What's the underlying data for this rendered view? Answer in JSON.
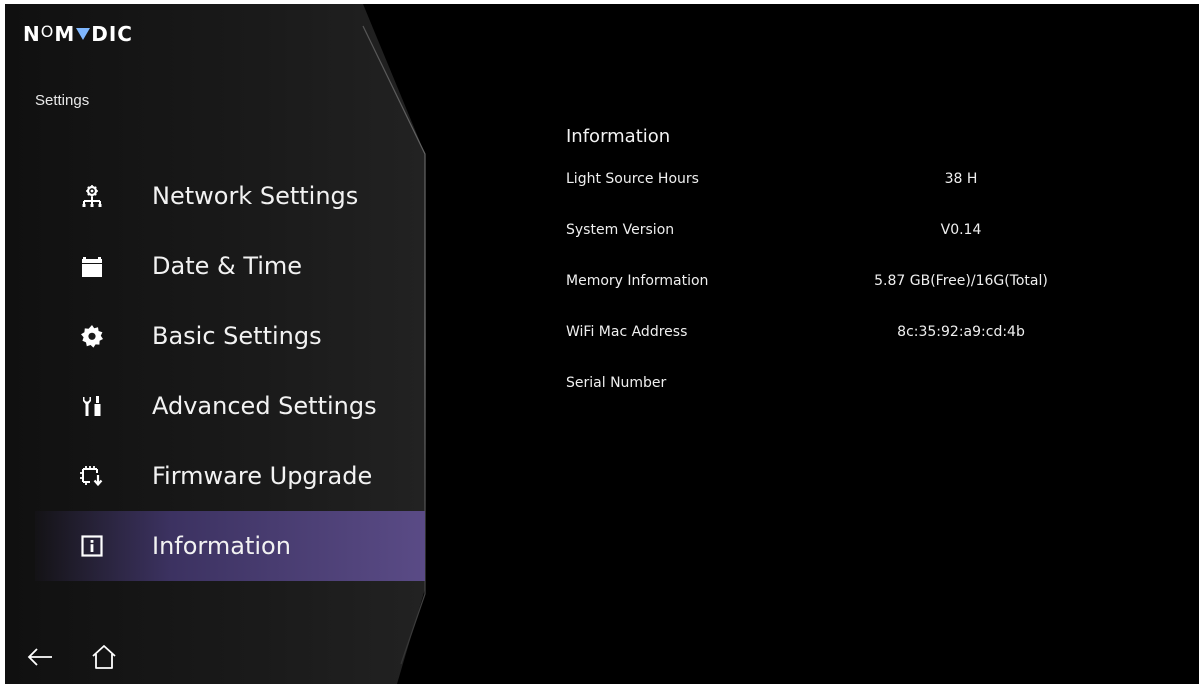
{
  "brand": {
    "logo_n": "N",
    "logo_o": "O",
    "logo_m": "M",
    "logo_rest": "DIC",
    "accent_color": "#7fb7ff"
  },
  "sidebar": {
    "title": "Settings",
    "items": [
      {
        "label": "Network Settings",
        "icon": "network-icon"
      },
      {
        "label": "Date & Time",
        "icon": "calendar-icon"
      },
      {
        "label": "Basic Settings",
        "icon": "gear-icon"
      },
      {
        "label": "Advanced Settings",
        "icon": "tools-icon"
      },
      {
        "label": "Firmware Upgrade",
        "icon": "firmware-upgrade-icon"
      },
      {
        "label": "Information",
        "icon": "info-icon",
        "selected": true
      }
    ],
    "selected_color": "#5a4b86"
  },
  "bottom_nav": {
    "back_icon": "back-arrow-icon",
    "home_icon": "home-icon"
  },
  "main": {
    "title": "Information",
    "rows": [
      {
        "key": "Light Source Hours",
        "value": "38 H"
      },
      {
        "key": "System Version",
        "value": "V0.14"
      },
      {
        "key": "Memory Information",
        "value": "5.87 GB(Free)/16G(Total)"
      },
      {
        "key": "WiFi Mac Address",
        "value": "8c:35:92:a9:cd:4b"
      },
      {
        "key": "Serial Number",
        "value": ""
      }
    ]
  }
}
